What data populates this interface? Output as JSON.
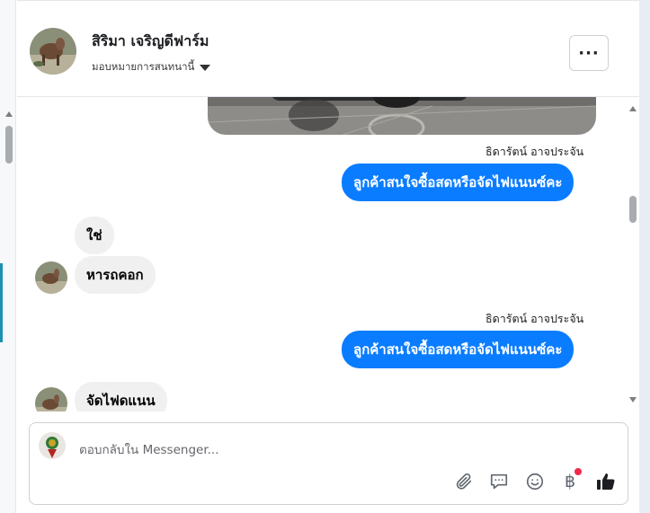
{
  "header": {
    "contact_name": "สิริมา เจริญดีฟาร์ม",
    "assign_label": "มอบหมายการสนทนานี้",
    "more_label": "···"
  },
  "messages": [
    {
      "type": "sender",
      "text": "ธิดารัตน์ อาจประจัน"
    },
    {
      "type": "outgoing",
      "text": "ลูกค้าสนใจซื้อสดหรือจัดไฟแนนซ์คะ"
    },
    {
      "type": "incoming",
      "text": "ใช่"
    },
    {
      "type": "incoming",
      "text": "หารถคอก"
    },
    {
      "type": "sender",
      "text": "ธิดารัตน์ อาจประจัน"
    },
    {
      "type": "outgoing",
      "text": "ลูกค้าสนใจซื้อสดหรือจัดไฟแนนซ์คะ"
    },
    {
      "type": "incoming",
      "text": "จัดไฟดแนน"
    }
  ],
  "composer": {
    "placeholder": "ตอบกลับใน Messenger...",
    "tools": [
      "paperclip-icon",
      "speech-bubble-icon",
      "smiley-icon",
      "baht-icon",
      "thumbs-up-icon"
    ],
    "baht_glyph": "฿"
  },
  "colors": {
    "outgoing_bubble": "#0a7cff",
    "incoming_bubble": "#f0f0f0",
    "badge": "#f02849"
  }
}
